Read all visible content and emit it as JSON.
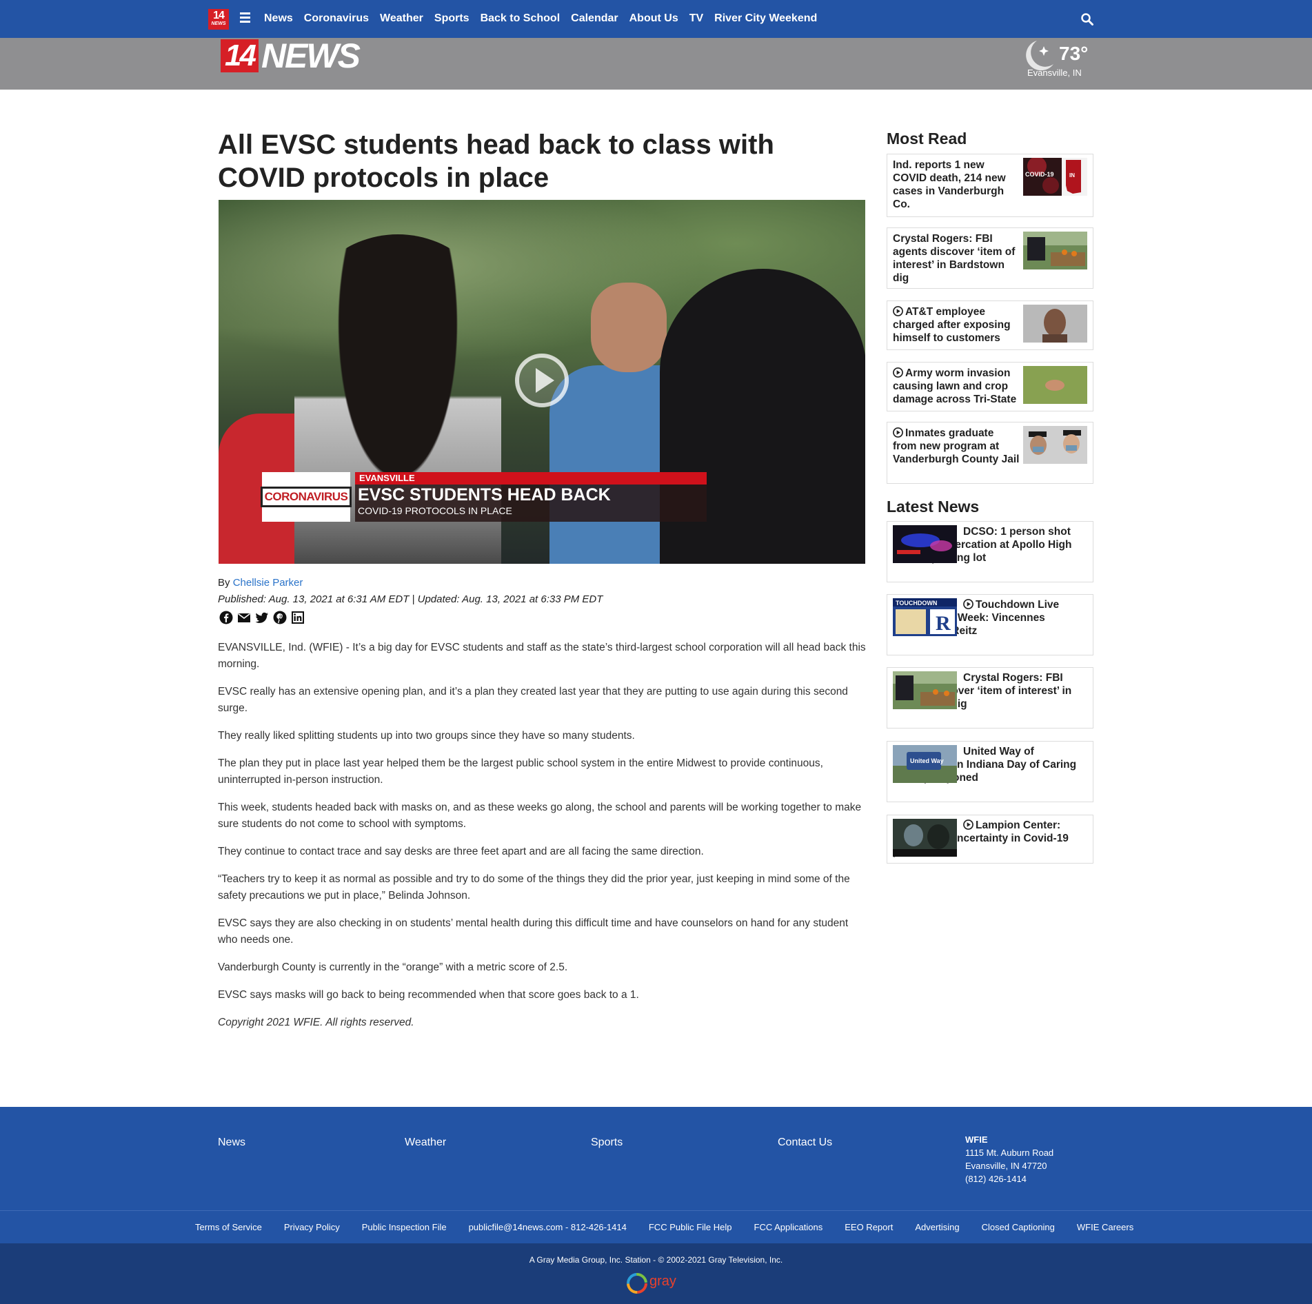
{
  "nav": {
    "logo_num": "14",
    "logo_sub": "NEWS",
    "items": [
      "News",
      "Coronavirus",
      "Weather",
      "Sports",
      "Back to School",
      "Calendar",
      "About Us",
      "TV",
      "River City Weekend"
    ]
  },
  "brand": {
    "logo_num": "14",
    "logo_word": "NEWS",
    "temperature": "73°",
    "city": "Evansville, IN"
  },
  "article": {
    "headline": "All EVSC students head back to class with COVID protocols in place",
    "video": {
      "tag": "CORONAVIRUS",
      "location": "EVANSVILLE",
      "title": "EVSC STUDENTS HEAD BACK",
      "subtitle": "COVID-19 PROTOCOLS IN PLACE"
    },
    "by_label": "By",
    "author": "Chellsie Parker",
    "dates": "Published: Aug. 13, 2021 at 6:31 AM EDT  |  Updated: Aug. 13, 2021 at 6:33 PM EDT",
    "paragraphs": [
      "EVANSVILLE, Ind. (WFIE) - It’s a big day for EVSC students and staff as the state’s third-largest school corporation will all head back this morning.",
      "EVSC really has an extensive opening plan, and it’s a plan they created last year that they are putting to use again during this second surge.",
      "They really liked splitting students up into two groups since they have so many students.",
      "The plan they put in place last year helped them be the largest public school system in the entire Midwest to provide continuous, uninterrupted in-person instruction.",
      "This week, students headed back with masks on, and as these weeks go along, the school and parents will be working together to make sure students do not come to school with symptoms.",
      "They continue to contact trace and say desks are three feet apart and are all facing the same direction.",
      "“Teachers try to keep it as normal as possible and try to do some of the things they did the prior year, just keeping in mind some of the safety precautions we put in place,” Belinda Johnson.",
      "EVSC says they are also checking in on students’ mental health during this difficult time and have counselors on hand for any student who needs one.",
      "Vanderburgh County is currently in the “orange” with a metric score of 2.5.",
      "EVSC says masks will go back to being recommended when that score goes back to a 1."
    ],
    "copyright": "Copyright 2021 WFIE. All rights reserved."
  },
  "sidebar": {
    "most_read_title": "Most Read",
    "most_read": [
      "Ind. reports 1 new COVID death, 214 new cases in Vanderburgh Co.",
      "Crystal Rogers: FBI agents discover ‘item of interest’ in Bardstown dig",
      "AT&T employee charged after exposing himself to customers",
      "Army worm invasion causing lawn and crop damage across Tri-State",
      "Inmates graduate from new program at Vanderburgh County Jail"
    ],
    "thumb_covid_text": "COVID-19",
    "thumb_state_text": "IN",
    "latest_title": "Latest News",
    "latest": [
      "DCSO: 1 person shot following altercation at Apollo High School parking lot",
      "Touchdown Live Game of the Week: Vincennes Lincoln vs. Reitz",
      "Crystal Rogers: FBI agents discover ‘item of interest’ in Bardstown dig",
      "United Way of Southwestern Indiana Day of Caring event postponed",
      "Lampion Center: Navigating uncertainty in Covid-19 pandemic"
    ],
    "thumb_touchdown_text": "TOUCHDOWN",
    "thumb_unitedway_text": "United Way"
  },
  "footer": {
    "links": [
      "News",
      "Weather",
      "Sports",
      "Contact Us"
    ],
    "station": "WFIE",
    "address1": "1115 Mt. Auburn Road",
    "address2": "Evansville, IN 47720",
    "phone": "(812) 426-1414",
    "legal": [
      "Terms of Service",
      "Privacy Policy",
      "Public Inspection File",
      "publicfile@14news.com - 812-426-1414",
      "FCC Public File Help",
      "FCC Applications",
      "EEO Report",
      "Advertising",
      "Closed Captioning",
      "WFIE Careers"
    ],
    "copyright": "A Gray Media Group, Inc. Station - © 2002-2021 Gray Television, Inc.",
    "gray_word": "gray"
  },
  "colors": {
    "nav_blue": "#2354a5",
    "brand_gray": "#8f8f91",
    "brand_red": "#d61f26",
    "link_blue": "#2a73c9",
    "footer_dark": "#1b3d79"
  },
  "icons": {
    "menu": "hamburger-icon",
    "search": "search-icon",
    "weather": "moon-icon",
    "play": "play-icon",
    "share": [
      "facebook-icon",
      "email-icon",
      "twitter-icon",
      "pinterest-icon",
      "linkedin-icon"
    ]
  }
}
